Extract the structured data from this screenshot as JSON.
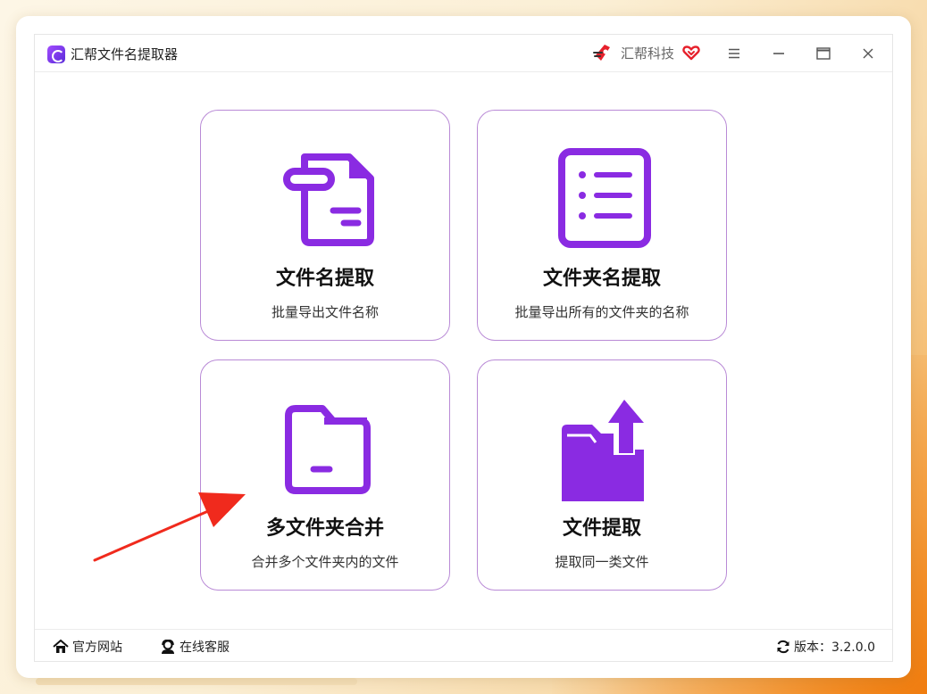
{
  "window": {
    "title": "汇帮文件名提取器",
    "brand": "汇帮科技"
  },
  "cards": [
    {
      "title": "文件名提取",
      "desc": "批量导出文件名称",
      "icon": "document-icon"
    },
    {
      "title": "文件夹名提取",
      "desc": "批量导出所有的文件夹的名称",
      "icon": "list-icon"
    },
    {
      "title": "多文件夹合并",
      "desc": "合并多个文件夹内的文件",
      "icon": "folder-icon"
    },
    {
      "title": "文件提取",
      "desc": "提取同一类文件",
      "icon": "folder-upload-icon"
    }
  ],
  "footer": {
    "website": "官方网站",
    "service": "在线客服",
    "version": "版本：3.2.0.0"
  },
  "colors": {
    "accent": "#8a2be2",
    "card_border": "#b98ad6",
    "annotation_arrow": "#f02a1d"
  }
}
